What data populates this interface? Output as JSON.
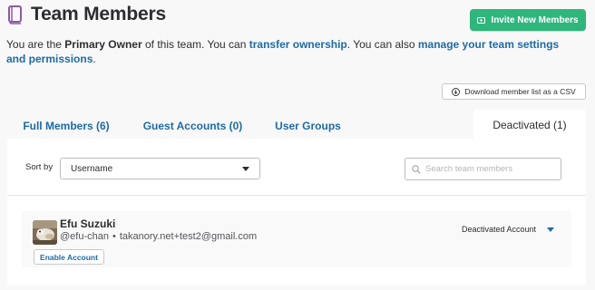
{
  "header": {
    "title": "Team Members",
    "icon": "book-icon",
    "invite_button": "Invite New Members"
  },
  "intro": {
    "part1": "You are the ",
    "role": "Primary Owner",
    "part2": " of this team. You can ",
    "link1": "transfer ownership",
    "part3": ". You can also ",
    "link2": "manage your team settings and permissions",
    "part4": "."
  },
  "download_button": "Download member list as a CSV",
  "tabs": [
    {
      "label": "Full Members (6)"
    },
    {
      "label": "Guest Accounts (0)"
    },
    {
      "label": "User Groups"
    },
    {
      "label": "Deactivated (1)"
    }
  ],
  "filters": {
    "sort_label": "Sort by",
    "sort_value": "Username",
    "search_placeholder": "Search team members"
  },
  "members": [
    {
      "name": "Efu Suzuki",
      "handle": "@efu-chan",
      "separator": "•",
      "email": "takanory.net+test2@gmail.com",
      "enable_button": "Enable Account",
      "status": "Deactivated Account"
    }
  ],
  "colors": {
    "accent_green": "#2fb67c",
    "link_blue": "#1e6ba6",
    "background": "#f8f8f8"
  }
}
